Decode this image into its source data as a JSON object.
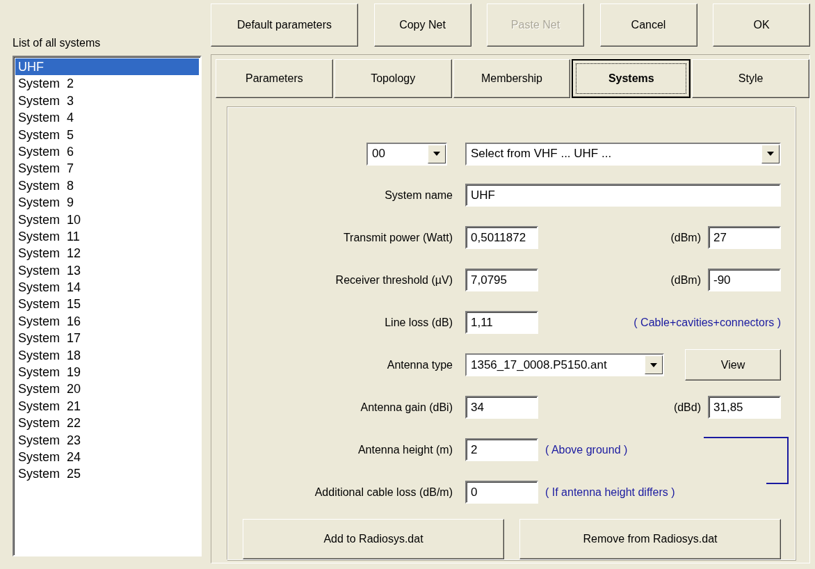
{
  "list": {
    "title": "List of all systems",
    "items": [
      {
        "label": "UHF",
        "selected": true
      },
      {
        "label": "System  2",
        "selected": false
      },
      {
        "label": "System  3",
        "selected": false
      },
      {
        "label": "System  4",
        "selected": false
      },
      {
        "label": "System  5",
        "selected": false
      },
      {
        "label": "System  6",
        "selected": false
      },
      {
        "label": "System  7",
        "selected": false
      },
      {
        "label": "System  8",
        "selected": false
      },
      {
        "label": "System  9",
        "selected": false
      },
      {
        "label": "System  10",
        "selected": false
      },
      {
        "label": "System  11",
        "selected": false
      },
      {
        "label": "System  12",
        "selected": false
      },
      {
        "label": "System  13",
        "selected": false
      },
      {
        "label": "System  14",
        "selected": false
      },
      {
        "label": "System  15",
        "selected": false
      },
      {
        "label": "System  16",
        "selected": false
      },
      {
        "label": "System  17",
        "selected": false
      },
      {
        "label": "System  18",
        "selected": false
      },
      {
        "label": "System  19",
        "selected": false
      },
      {
        "label": "System  20",
        "selected": false
      },
      {
        "label": "System  21",
        "selected": false
      },
      {
        "label": "System  22",
        "selected": false
      },
      {
        "label": "System  23",
        "selected": false
      },
      {
        "label": "System  24",
        "selected": false
      },
      {
        "label": "System  25",
        "selected": false
      }
    ]
  },
  "buttons": [
    {
      "label": "Default parameters",
      "disabled": false
    },
    {
      "label": "Copy Net",
      "disabled": false
    },
    {
      "label": "Paste Net",
      "disabled": true
    },
    {
      "label": "Cancel",
      "disabled": false
    },
    {
      "label": "OK",
      "disabled": false
    }
  ],
  "tabs": [
    {
      "label": "Parameters",
      "selected": false
    },
    {
      "label": "Topology",
      "selected": false
    },
    {
      "label": "Membership",
      "selected": false
    },
    {
      "label": "Systems",
      "selected": true
    },
    {
      "label": "Style",
      "selected": false
    }
  ],
  "selector": {
    "index": "00",
    "system": "Select from VHF ... UHF ..."
  },
  "rows": [
    {
      "kind": "wide",
      "label": "System name",
      "value": "UHF"
    },
    {
      "kind": "pair",
      "label": "Transmit power (Watt)",
      "value": "0,5011872",
      "unit": "(dBm)",
      "value2": "27"
    },
    {
      "kind": "pair",
      "label": "Receiver threshold (µV)",
      "value": "7,0795",
      "unit": "(dBm)",
      "value2": "-90"
    },
    {
      "kind": "remark",
      "label": "Line loss (dB)",
      "value": "1,11",
      "note": "( Cable+cavities+connectors )"
    },
    {
      "kind": "combo",
      "label": "Antenna type",
      "value": "1356_17_0008.P5150.ant",
      "button": "View"
    },
    {
      "kind": "pair",
      "label": "Antenna gain (dBi)",
      "value": "34",
      "unit": "(dBd)",
      "value2": "31,85"
    },
    {
      "kind": "note",
      "label": "Antenna height (m)",
      "value": "2",
      "note": "( Above ground )"
    },
    {
      "kind": "note",
      "label": "Additional cable loss (dB/m)",
      "value": "0",
      "note": "( If antenna height differs )"
    }
  ],
  "actions": [
    "Add to Radiosys.dat",
    "Remove from Radiosys.dat"
  ]
}
